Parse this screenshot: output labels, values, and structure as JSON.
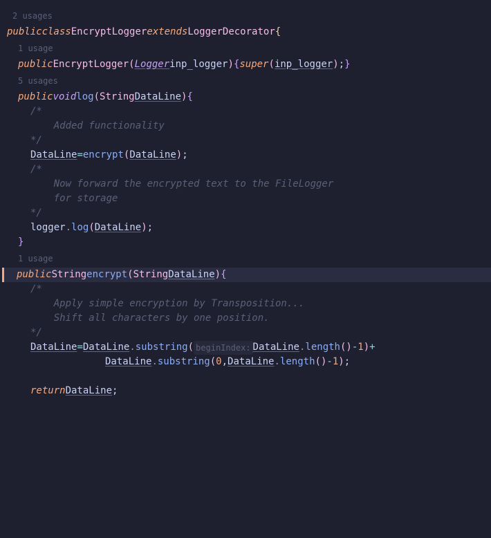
{
  "usages": {
    "class": "2 usages",
    "ctor": "1 usage",
    "log": "5 usages",
    "encrypt": "1 usage"
  },
  "tokens": {
    "public": "public",
    "class": "class",
    "extends": "extends",
    "void": "void",
    "super": "super",
    "return": "return",
    "EncryptLogger": "EncryptLogger",
    "LoggerDecorator": "LoggerDecorator",
    "Logger": "Logger",
    "String": "String",
    "inp_logger": "inp_logger",
    "DataLine": "DataLine",
    "log": "log",
    "encrypt": "encrypt",
    "logger": "logger",
    "substring": "substring",
    "length": "length",
    "beginIndex": "beginIndex:",
    "zero": "0",
    "one": "1",
    "minus": "-",
    "plus": "+",
    "eq": "=",
    "dot": ".",
    "comma": ",",
    "semi": ";",
    "lparen": "(",
    "rparen": ")",
    "lbrace": "{",
    "rbrace": "}"
  },
  "comments": {
    "open": "/*",
    "close": "*/",
    "added": "    Added functionality",
    "forward1": "    Now forward the encrypted text to the FileLogger",
    "forward2": "    for storage",
    "trans1": "    Apply simple encryption by Transposition...",
    "trans2": "    Shift all characters by one position."
  }
}
